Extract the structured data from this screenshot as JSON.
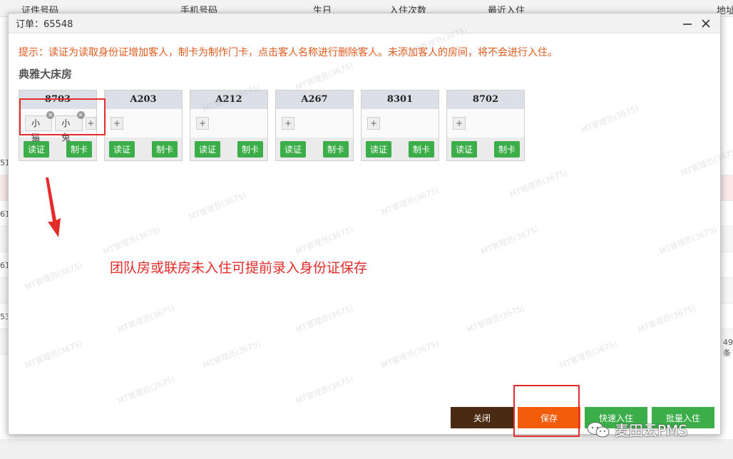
{
  "background": {
    "headers": [
      "证件号码",
      "手机号码",
      "生日",
      "入住次数",
      "最近入住",
      "地址"
    ],
    "row_fragments": [
      "51",
      "61",
      "61",
      "53"
    ],
    "right_fragment": "49 条"
  },
  "modal": {
    "title": "订单：65548",
    "tip": "提示：读证为读取身份证增加客人，制卡为制作门卡，点击客人名称进行删除客人。未添加客人的房间，将不会进行入住。",
    "room_type": "典雅大床房",
    "rooms": [
      {
        "number": "8703",
        "guests": [
          "小猫",
          "小兔"
        ],
        "read_label": "读证",
        "card_label": "制卡"
      },
      {
        "number": "A203",
        "guests": [],
        "read_label": "读证",
        "card_label": "制卡"
      },
      {
        "number": "A212",
        "guests": [],
        "read_label": "读证",
        "card_label": "制卡"
      },
      {
        "number": "A267",
        "guests": [],
        "read_label": "读证",
        "card_label": "制卡"
      },
      {
        "number": "8301",
        "guests": [],
        "read_label": "读证",
        "card_label": "制卡"
      },
      {
        "number": "8702",
        "guests": [],
        "read_label": "读证",
        "card_label": "制卡"
      }
    ],
    "plus_label": "+",
    "annotation": "团队房或联房未入住可提前录入身份证保存",
    "buttons": {
      "close": "关闭",
      "save": "保存",
      "quick_checkin": "快速入住",
      "batch_checkin": "批量入住"
    }
  },
  "watermark_text": "MT管理员(3675)",
  "wechat_label": "麦田云PMS",
  "colors": {
    "tip": "#e25a1c",
    "annotation": "#e62b2b",
    "green": "#3bae49",
    "orange": "#f25c0a",
    "dark": "#4b2a14"
  },
  "icons": {
    "minimize": "minimize-icon",
    "close": "close-icon",
    "arrow": "arrow-down-icon",
    "wechat": "wechat-icon"
  }
}
